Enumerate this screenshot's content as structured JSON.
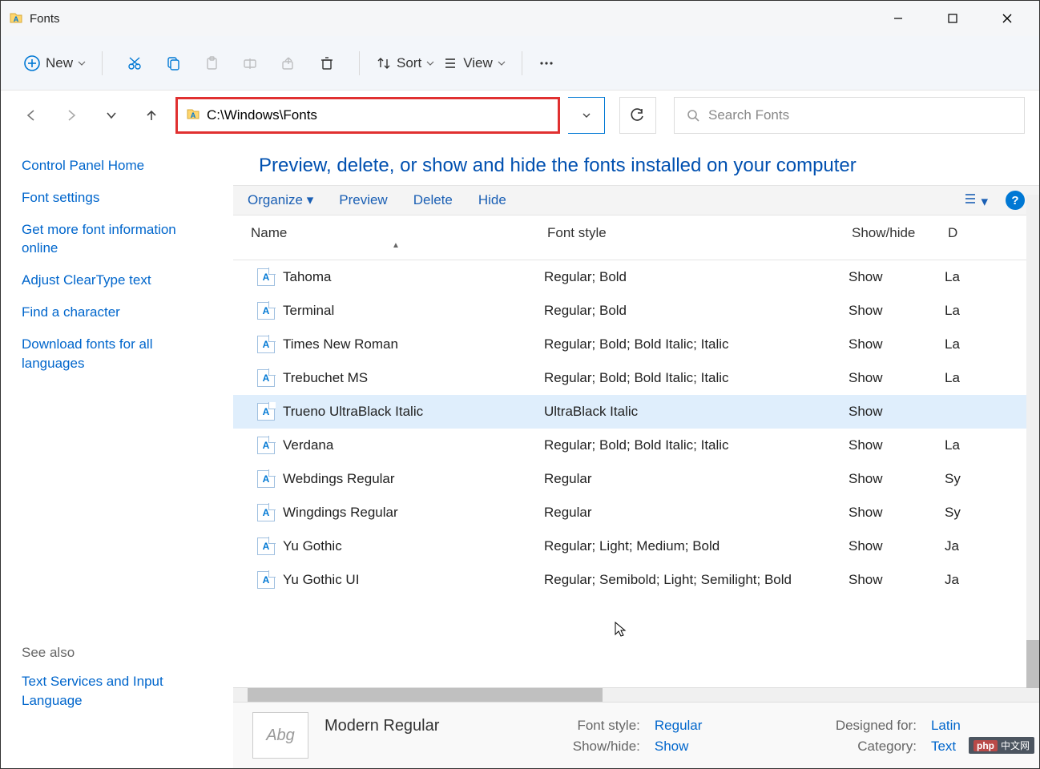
{
  "window": {
    "title": "Fonts"
  },
  "toolbar": {
    "new": "New",
    "sort": "Sort",
    "view": "View"
  },
  "address": {
    "path": "C:\\Windows\\Fonts"
  },
  "search": {
    "placeholder": "Search Fonts"
  },
  "sidebar": {
    "links": [
      "Control Panel Home",
      "Font settings",
      "Get more font information online",
      "Adjust ClearType text",
      "Find a character",
      "Download fonts for all languages"
    ],
    "seealso_label": "See also",
    "seealso_links": [
      "Text Services and Input Language"
    ]
  },
  "main": {
    "heading": "Preview, delete, or show and hide the fonts installed on your computer",
    "cmds": {
      "organize": "Organize",
      "preview": "Preview",
      "delete": "Delete",
      "hide": "Hide"
    },
    "columns": {
      "name": "Name",
      "style": "Font style",
      "show": "Show/hide",
      "d": "D"
    },
    "rows": [
      {
        "name": "Tahoma",
        "style": "Regular; Bold",
        "show": "Show",
        "d": "La",
        "selected": false
      },
      {
        "name": "Terminal",
        "style": "Regular; Bold",
        "show": "Show",
        "d": "La",
        "selected": false
      },
      {
        "name": "Times New Roman",
        "style": "Regular; Bold; Bold Italic; Italic",
        "show": "Show",
        "d": "La",
        "selected": false
      },
      {
        "name": "Trebuchet MS",
        "style": "Regular; Bold; Bold Italic; Italic",
        "show": "Show",
        "d": "La",
        "selected": false
      },
      {
        "name": "Trueno UltraBlack Italic",
        "style": "UltraBlack Italic",
        "show": "Show",
        "d": "",
        "selected": true
      },
      {
        "name": "Verdana",
        "style": "Regular; Bold; Bold Italic; Italic",
        "show": "Show",
        "d": "La",
        "selected": false
      },
      {
        "name": "Webdings Regular",
        "style": "Regular",
        "show": "Show",
        "d": "Sy",
        "selected": false
      },
      {
        "name": "Wingdings Regular",
        "style": "Regular",
        "show": "Show",
        "d": "Sy",
        "selected": false
      },
      {
        "name": "Yu Gothic",
        "style": "Regular; Light; Medium; Bold",
        "show": "Show",
        "d": "Ja",
        "selected": false
      },
      {
        "name": "Yu Gothic UI",
        "style": "Regular; Semibold; Light; Semilight; Bold",
        "show": "Show",
        "d": "Ja",
        "selected": false
      }
    ],
    "preview": {
      "thumb_text": "Abg",
      "title": "Modern Regular",
      "labels": {
        "fontstyle": "Font style:",
        "showhide": "Show/hide:",
        "designed": "Designed for:",
        "category": "Category:"
      },
      "values": {
        "fontstyle": "Regular",
        "showhide": "Show",
        "designed": "Latin",
        "category": "Text"
      }
    }
  },
  "badge": {
    "a": "php",
    "b": "中文网"
  }
}
